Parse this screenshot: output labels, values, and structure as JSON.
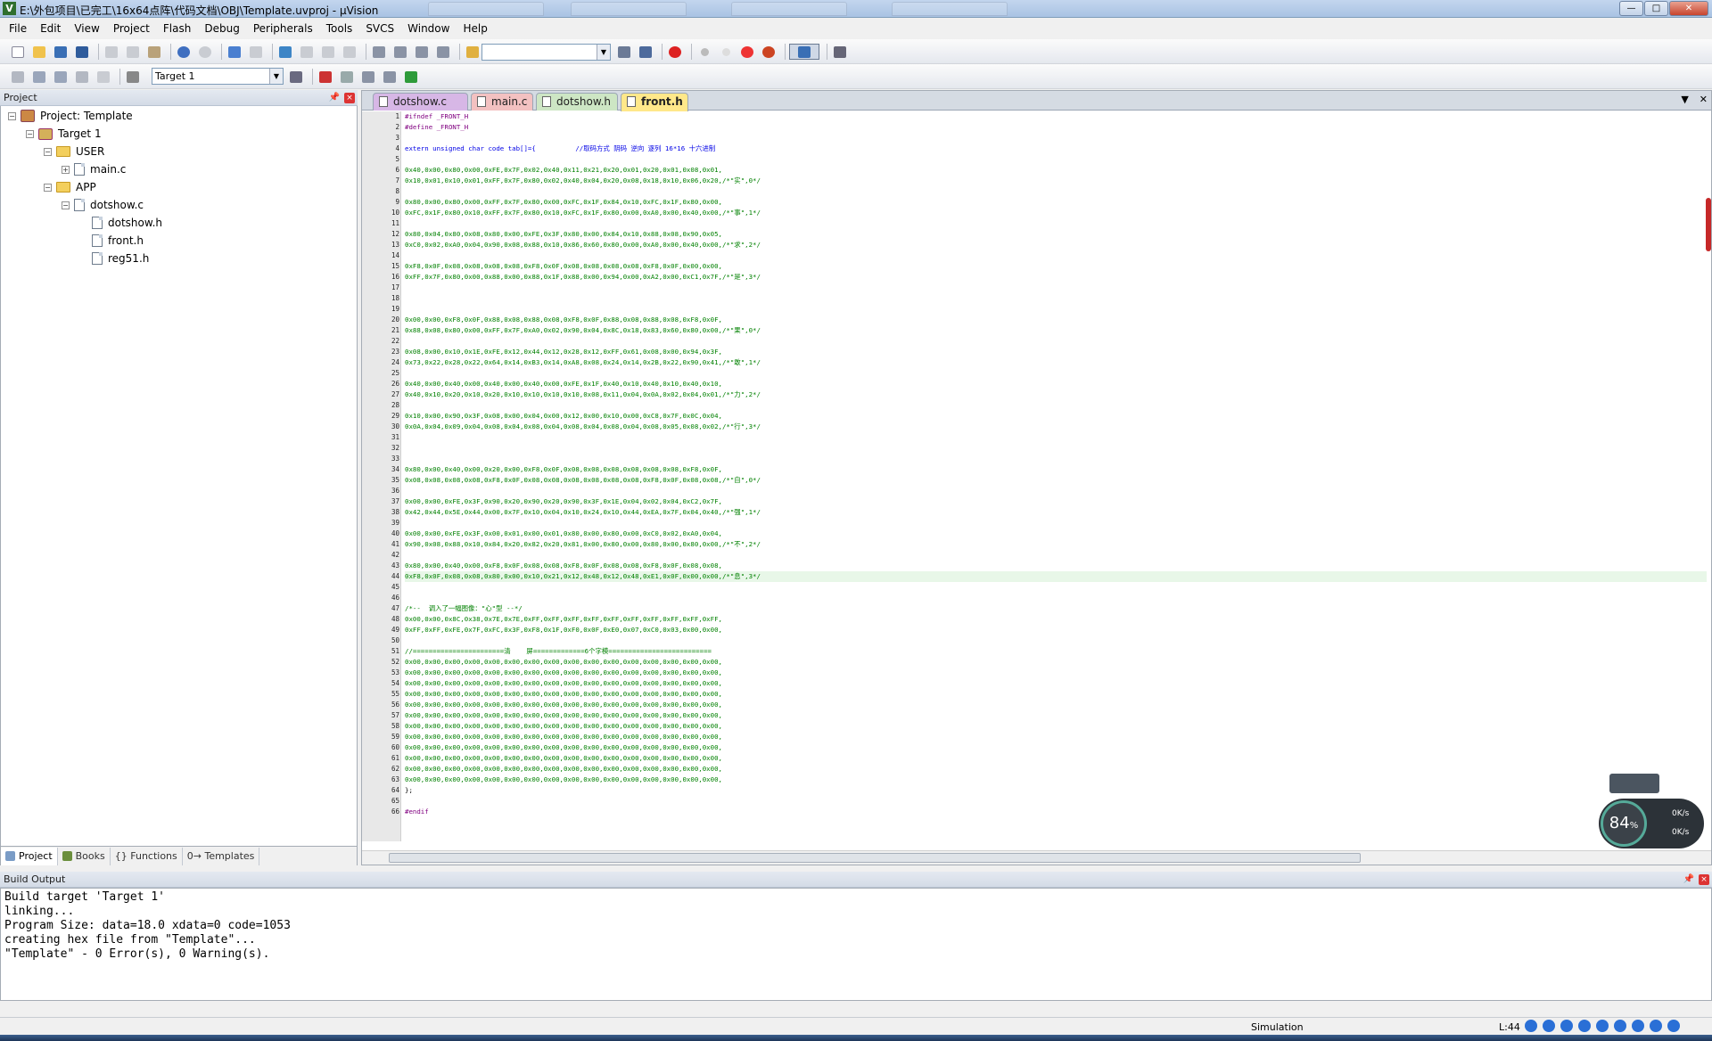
{
  "window": {
    "title": "E:\\外包项目\\已完工\\16x64点阵\\代码文档\\OBJ\\Template.uvproj - µVision",
    "minimize": "—",
    "maximize": "□",
    "close": "✕"
  },
  "menu": [
    "File",
    "Edit",
    "View",
    "Project",
    "Flash",
    "Debug",
    "Peripherals",
    "Tools",
    "SVCS",
    "Window",
    "Help"
  ],
  "toolbar": {
    "target_label": "Target 1"
  },
  "project_panel": {
    "title": "Project",
    "tree": [
      {
        "label": "Project: Template",
        "kind": "project",
        "expand": "−"
      },
      {
        "label": "Target 1",
        "kind": "target",
        "expand": "−"
      },
      {
        "label": "USER",
        "kind": "folder",
        "expand": "−"
      },
      {
        "label": "main.c",
        "kind": "file",
        "expand": "+"
      },
      {
        "label": "APP",
        "kind": "folder",
        "expand": "−"
      },
      {
        "label": "dotshow.c",
        "kind": "file",
        "expand": "−"
      },
      {
        "label": "dotshow.h",
        "kind": "file",
        "expand": ""
      },
      {
        "label": "front.h",
        "kind": "file",
        "expand": ""
      },
      {
        "label": "reg51.h",
        "kind": "file",
        "expand": ""
      }
    ],
    "tabs": [
      "Project",
      "Books",
      "{} Functions",
      "0→ Templates"
    ]
  },
  "editor": {
    "tabs": [
      "dotshow.c",
      "main.c",
      "dotshow.h",
      "front.h"
    ],
    "active_tab": "front.h",
    "current_line": 44,
    "lines": [
      "#ifndef _FRONT_H",
      "#define _FRONT_H",
      "",
      "extern unsigned char code tab[]={          //取码方式 阴码 逆向 逐列 16*16 十六进制",
      "",
      "0x40,0x00,0x80,0x00,0xFE,0x7F,0x02,0x40,0x11,0x21,0x20,0x01,0x20,0x01,0x08,0x01,",
      "0x10,0x01,0x10,0x01,0xFF,0x7F,0x80,0x02,0x40,0x04,0x20,0x08,0x18,0x10,0x06,0x20,/*\"实\",0*/",
      "",
      "0x80,0x00,0x80,0x00,0xFF,0x7F,0x80,0x00,0xFC,0x1F,0x84,0x10,0xFC,0x1F,0x80,0x00,",
      "0xFC,0x1F,0x80,0x10,0xFF,0x7F,0x80,0x10,0xFC,0x1F,0x80,0x00,0xA0,0x00,0x40,0x00,/*\"事\",1*/",
      "",
      "0x80,0x04,0x80,0x08,0x80,0x00,0xFE,0x3F,0x80,0x00,0x84,0x10,0x88,0x08,0x90,0x05,",
      "0xC0,0x02,0xA0,0x04,0x90,0x08,0x88,0x10,0x86,0x60,0x80,0x00,0xA0,0x00,0x40,0x00,/*\"求\",2*/",
      "",
      "0xF8,0x0F,0x08,0x08,0x08,0x08,0xF8,0x0F,0x08,0x08,0x08,0x08,0xF8,0x0F,0x00,0x00,",
      "0xFF,0x7F,0x80,0x00,0x88,0x00,0x88,0x1F,0x88,0x00,0x94,0x00,0xA2,0x00,0xC1,0x7F,/*\"是\",3*/",
      "",
      "",
      "",
      "0x00,0x00,0xF8,0x0F,0x88,0x08,0x88,0x08,0xF8,0x0F,0x88,0x08,0x88,0x08,0xF8,0x0F,",
      "0x88,0x08,0x80,0x00,0xFF,0x7F,0xA0,0x02,0x90,0x04,0x8C,0x18,0x83,0x60,0x80,0x00,/*\"果\",0*/",
      "",
      "0x08,0x00,0x10,0x1E,0xFE,0x12,0x44,0x12,0x28,0x12,0xFF,0x61,0x08,0x00,0x94,0x3F,",
      "0x73,0x22,0x28,0x22,0x64,0x14,0xB3,0x14,0xA8,0x08,0x24,0x14,0x2B,0x22,0x90,0x41,/*\"敢\",1*/",
      "",
      "0x40,0x00,0x40,0x00,0x40,0x00,0x40,0x00,0xFE,0x1F,0x40,0x10,0x40,0x10,0x40,0x10,",
      "0x40,0x10,0x20,0x10,0x20,0x10,0x10,0x10,0x10,0x08,0x11,0x04,0x0A,0x02,0x04,0x01,/*\"力\",2*/",
      "",
      "0x10,0x00,0x90,0x3F,0x08,0x00,0x04,0x00,0x12,0x00,0x10,0x00,0xC8,0x7F,0x0C,0x04,",
      "0x0A,0x04,0x09,0x04,0x08,0x04,0x08,0x04,0x08,0x04,0x08,0x04,0x08,0x05,0x08,0x02,/*\"行\",3*/",
      "",
      "",
      "",
      "0x80,0x00,0x40,0x00,0x20,0x00,0xF8,0x0F,0x08,0x08,0x08,0x08,0x08,0x08,0xF8,0x0F,",
      "0x08,0x08,0x08,0x08,0xF8,0x0F,0x08,0x08,0x08,0x08,0x08,0x08,0xF8,0x0F,0x08,0x08,/*\"自\",0*/",
      "",
      "0x00,0x00,0xFE,0x3F,0x90,0x20,0x90,0x20,0x90,0x3F,0x1E,0x04,0x02,0x04,0xC2,0x7F,",
      "0x42,0x44,0x5E,0x44,0x00,0x7F,0x10,0x04,0x10,0x24,0x10,0x44,0xEA,0x7F,0x04,0x40,/*\"强\",1*/",
      "",
      "0x00,0x00,0xFE,0x3F,0x00,0x01,0x00,0x01,0x80,0x00,0x80,0x00,0xC0,0x02,0xA0,0x04,",
      "0x90,0x08,0x88,0x10,0x84,0x20,0x82,0x20,0x81,0x00,0x80,0x00,0x80,0x00,0x80,0x00,/*\"不\",2*/",
      "",
      "0x80,0x00,0x40,0x00,0xF8,0x0F,0x08,0x08,0xF8,0x0F,0x08,0x08,0xF8,0x0F,0x08,0x08,",
      "0xF8,0x0F,0x08,0x08,0x80,0x00,0x10,0x21,0x12,0x48,0x12,0x48,0xE1,0x0F,0x00,0x00,/*\"息\",3*/",
      "",
      "",
      "/*--  调入了一幅图像：\"心\"型 --*/",
      "0x00,0x00,0x8C,0x38,0x7E,0x7E,0xFF,0xFF,0xFF,0xFF,0xFF,0xFF,0xFF,0xFF,0xFF,0xFF,",
      "0xFF,0xFF,0xFE,0x7F,0xFC,0x3F,0xF8,0x1F,0xF0,0x0F,0xE0,0x07,0xC0,0x03,0x00,0x00,",
      "",
      "//=======================清    屏=============6个字模==========================",
      "0x00,0x00,0x00,0x00,0x00,0x00,0x00,0x00,0x00,0x00,0x00,0x00,0x00,0x00,0x00,0x00,",
      "0x00,0x00,0x00,0x00,0x00,0x00,0x00,0x00,0x00,0x00,0x00,0x00,0x00,0x00,0x00,0x00,",
      "0x00,0x00,0x00,0x00,0x00,0x00,0x00,0x00,0x00,0x00,0x00,0x00,0x00,0x00,0x00,0x00,",
      "0x00,0x00,0x00,0x00,0x00,0x00,0x00,0x00,0x00,0x00,0x00,0x00,0x00,0x00,0x00,0x00,",
      "0x00,0x00,0x00,0x00,0x00,0x00,0x00,0x00,0x00,0x00,0x00,0x00,0x00,0x00,0x00,0x00,",
      "0x00,0x00,0x00,0x00,0x00,0x00,0x00,0x00,0x00,0x00,0x00,0x00,0x00,0x00,0x00,0x00,",
      "0x00,0x00,0x00,0x00,0x00,0x00,0x00,0x00,0x00,0x00,0x00,0x00,0x00,0x00,0x00,0x00,",
      "0x00,0x00,0x00,0x00,0x00,0x00,0x00,0x00,0x00,0x00,0x00,0x00,0x00,0x00,0x00,0x00,",
      "0x00,0x00,0x00,0x00,0x00,0x00,0x00,0x00,0x00,0x00,0x00,0x00,0x00,0x00,0x00,0x00,",
      "0x00,0x00,0x00,0x00,0x00,0x00,0x00,0x00,0x00,0x00,0x00,0x00,0x00,0x00,0x00,0x00,",
      "0x00,0x00,0x00,0x00,0x00,0x00,0x00,0x00,0x00,0x00,0x00,0x00,0x00,0x00,0x00,0x00,",
      "0x00,0x00,0x00,0x00,0x00,0x00,0x00,0x00,0x00,0x00,0x00,0x00,0x00,0x00,0x00,0x00,",
      "};",
      "",
      "#endif"
    ]
  },
  "build_output": {
    "title": "Build Output",
    "lines": [
      "Build target 'Target 1'",
      "linking...",
      "Program Size: data=18.0 xdata=0 code=1053",
      "creating hex file from \"Template\"...",
      "\"Template\" - 0 Error(s), 0 Warning(s)."
    ]
  },
  "statusbar": {
    "mode": "Simulation",
    "position": "L:44"
  },
  "speed_widget": {
    "percent": "84",
    "percent_unit": "%",
    "up": "0K/s",
    "down": "0K/s"
  }
}
